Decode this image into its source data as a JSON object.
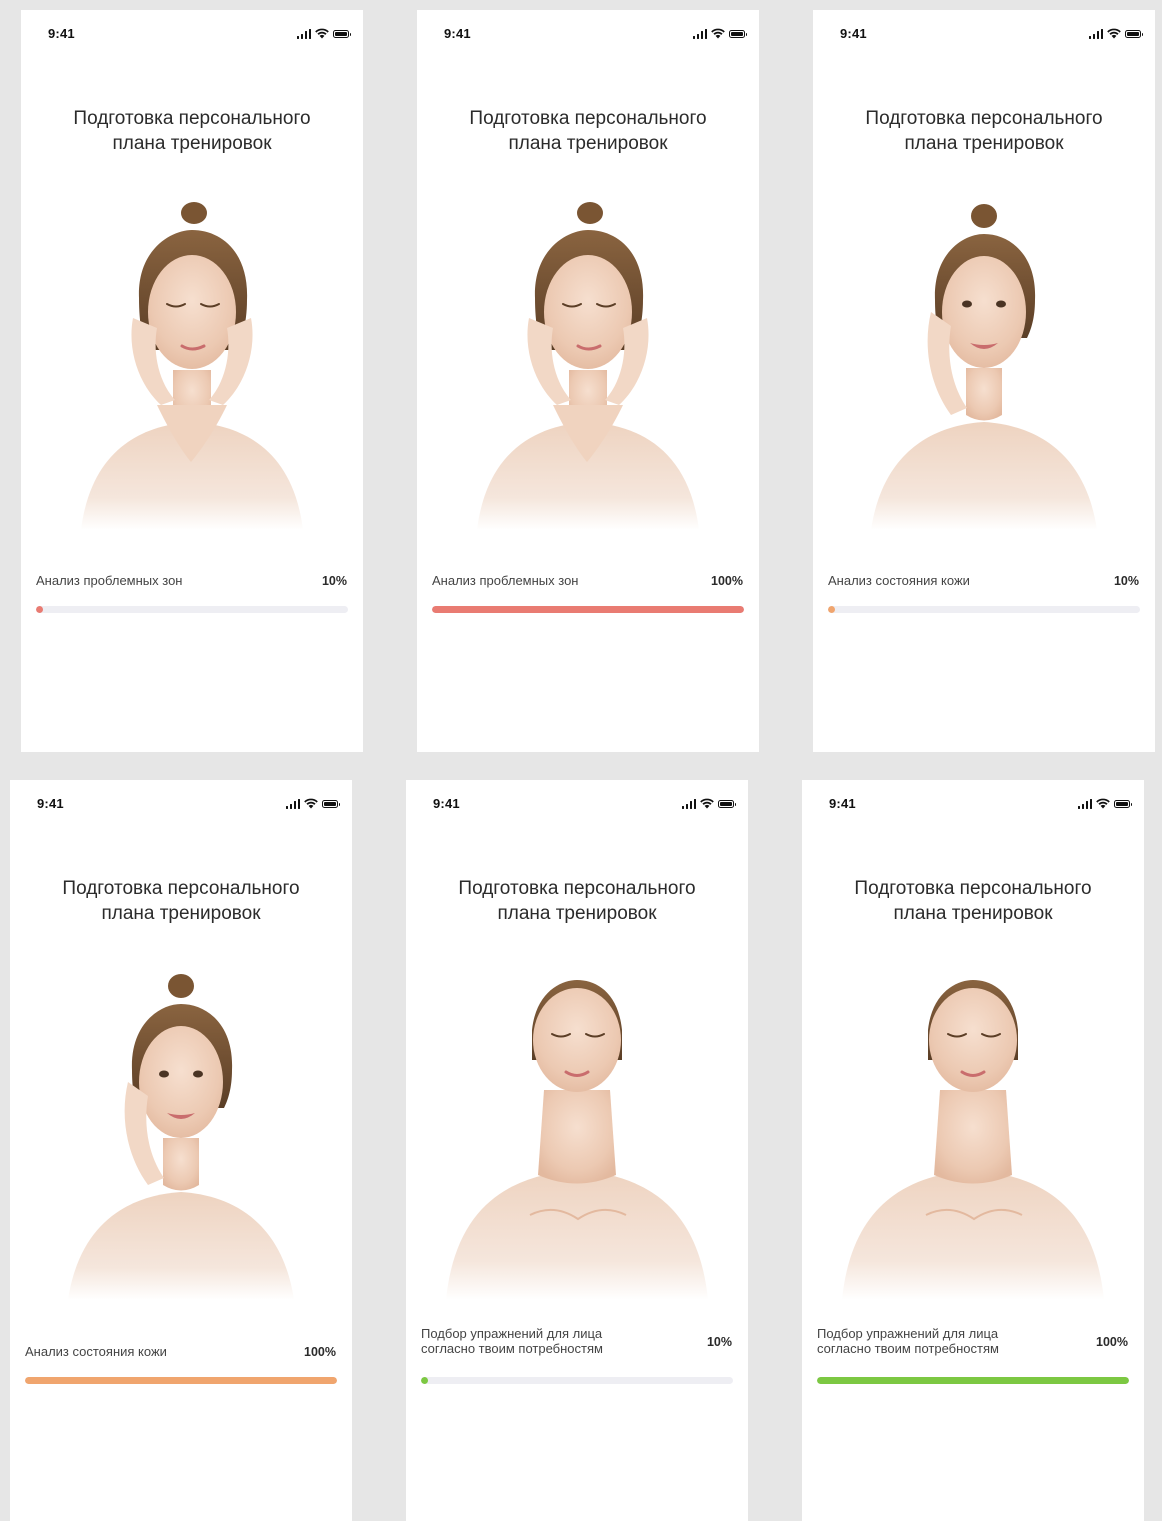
{
  "screens": [
    {
      "time": "9:41",
      "title_line1": "Подготовка персонального",
      "title_line2": "плана тренировок",
      "pose": "hands-both-cheeks",
      "step_label": "Анализ проблемных зон",
      "percent_label": "10%",
      "progress": 0.02,
      "accent_color": "#e97b72"
    },
    {
      "time": "9:41",
      "title_line1": "Подготовка персонального",
      "title_line2": "плана тренировок",
      "pose": "hands-both-cheeks",
      "step_label": "Анализ проблемных зон",
      "percent_label": "100%",
      "progress": 1.0,
      "accent_color": "#e97b72"
    },
    {
      "time": "9:41",
      "title_line1": "Подготовка персонального",
      "title_line2": "плана тренировок",
      "pose": "hand-one-cheek",
      "step_label": "Анализ состояния кожи",
      "percent_label": "10%",
      "progress": 0.02,
      "accent_color": "#f0a56e"
    },
    {
      "time": "9:41",
      "title_line1": "Подготовка персонального",
      "title_line2": "плана тренировок",
      "pose": "hand-one-cheek",
      "step_label": "Анализ состояния кожи",
      "percent_label": "100%",
      "progress": 1.0,
      "accent_color": "#f0a56e"
    },
    {
      "time": "9:41",
      "title_line1": "Подготовка персонального",
      "title_line2": "плана тренировок",
      "pose": "head-tilted-back",
      "step_label": "Подбор упражнений для лица согласно твоим потребностям",
      "percent_label": "10%",
      "progress": 0.02,
      "accent_color": "#7cc842"
    },
    {
      "time": "9:41",
      "title_line1": "Подготовка персонального",
      "title_line2": "плана тренировок",
      "pose": "head-tilted-back",
      "step_label": "Подбор упражнений для лица согласно твоим потребностям",
      "percent_label": "100%",
      "progress": 1.0,
      "accent_color": "#7cc842"
    }
  ],
  "icons": {
    "signal": "cellular-signal-icon",
    "wifi": "wifi-icon",
    "battery": "battery-icon"
  }
}
